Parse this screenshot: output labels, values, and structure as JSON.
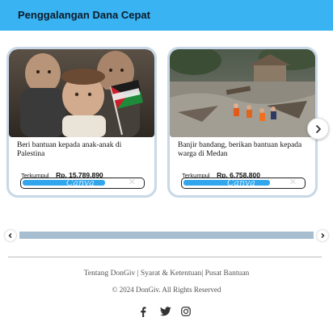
{
  "header": {
    "title": "Penggalangan Dana Cepat"
  },
  "campaigns": [
    {
      "title": "Beri bantuan kepada anak-anak di Palestina",
      "raised_label": "Terkumpul",
      "raised_amount": "Rp. 15.789.890",
      "progress_watermark": "Canva",
      "progress_fraction": 0.68,
      "accent": "#32a6ec"
    },
    {
      "title": "Banjir bandang, berikan bantuan kepada warga di Medan",
      "raised_label": "Terkumpul",
      "raised_amount": "Rp. 6.758.800",
      "progress_watermark": "Canva",
      "progress_fraction": 0.71,
      "accent": "#32a6ec"
    }
  ],
  "carousel": {
    "next_icon": "chevron-right-icon",
    "scroll_left_icon": "caret-left-icon",
    "scroll_right_icon": "caret-right-icon"
  },
  "footer": {
    "links": "Tentang DonGiv | Syarat & Ketentuan| Pusat Bantuan",
    "copyright": "© 2024 DonGiv. All Rights Reserved",
    "social_icons": [
      "facebook-icon",
      "twitter-icon",
      "instagram-icon"
    ]
  },
  "colors": {
    "header_bg": "#39b3f2",
    "progress": "#32a6ec",
    "scroll_track": "#a6bed0"
  }
}
